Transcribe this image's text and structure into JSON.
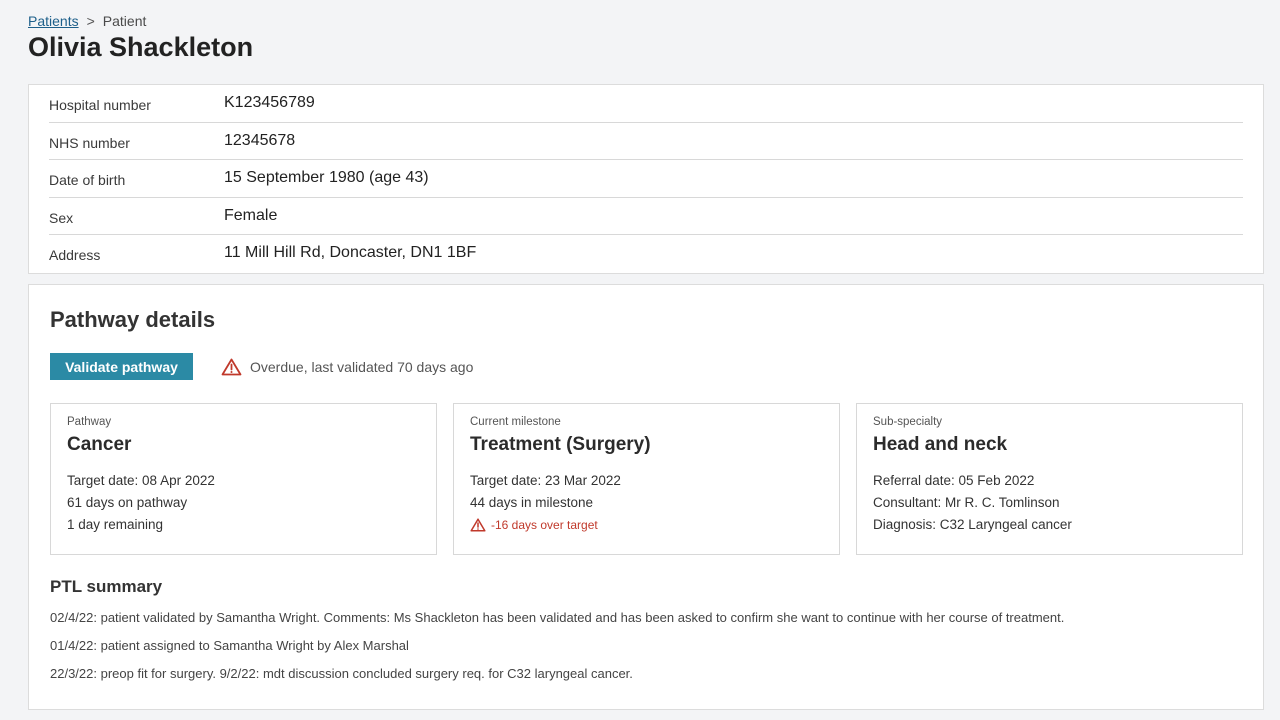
{
  "breadcrumb": {
    "link": "Patients",
    "sep": ">",
    "current": "Patient"
  },
  "patient": {
    "name": "Olivia Shackleton"
  },
  "info": [
    {
      "label": "Hospital number",
      "value": "K123456789"
    },
    {
      "label": "NHS number",
      "value": "12345678"
    },
    {
      "label": "Date of birth",
      "value": "15 September 1980 (age 43)"
    },
    {
      "label": "Sex",
      "value": "Female"
    },
    {
      "label": "Address",
      "value": "11 Mill Hill Rd, Doncaster, DN1 1BF"
    }
  ],
  "pathway": {
    "title": "Pathway details",
    "validate_label": "Validate pathway",
    "overdue_text": "Overdue, last validated 70 days ago",
    "boxes": [
      {
        "caption": "Pathway",
        "heading": "Cancer",
        "lines": [
          "Target date: 08 Apr 2022",
          "61 days on pathway",
          "1 day remaining"
        ]
      },
      {
        "caption": "Current milestone",
        "heading": "Treatment (Surgery)",
        "lines": [
          "Target date: 23 Mar 2022",
          "44 days in milestone"
        ],
        "warning": "-16 days over target"
      },
      {
        "caption": "Sub-specialty",
        "heading": "Head and neck",
        "lines": [
          "Referral date: 05 Feb 2022",
          "Consultant: Mr R. C. Tomlinson",
          "Diagnosis: C32 Laryngeal cancer"
        ]
      }
    ]
  },
  "ptl": {
    "title": "PTL summary",
    "items": [
      "02/4/22: patient validated by Samantha Wright. Comments: Ms Shackleton has been validated and has been asked to confirm she want to continue with her course of treatment.",
      "01/4/22: patient assigned to Samantha Wright by Alex Marshal",
      "22/3/22: preop fit for surgery. 9/2/22: mdt discussion concluded surgery req. for C32 laryngeal cancer."
    ]
  },
  "colors": {
    "accent": "#2b8aa5",
    "warning": "#c0392b",
    "link": "#1d5f8a"
  }
}
